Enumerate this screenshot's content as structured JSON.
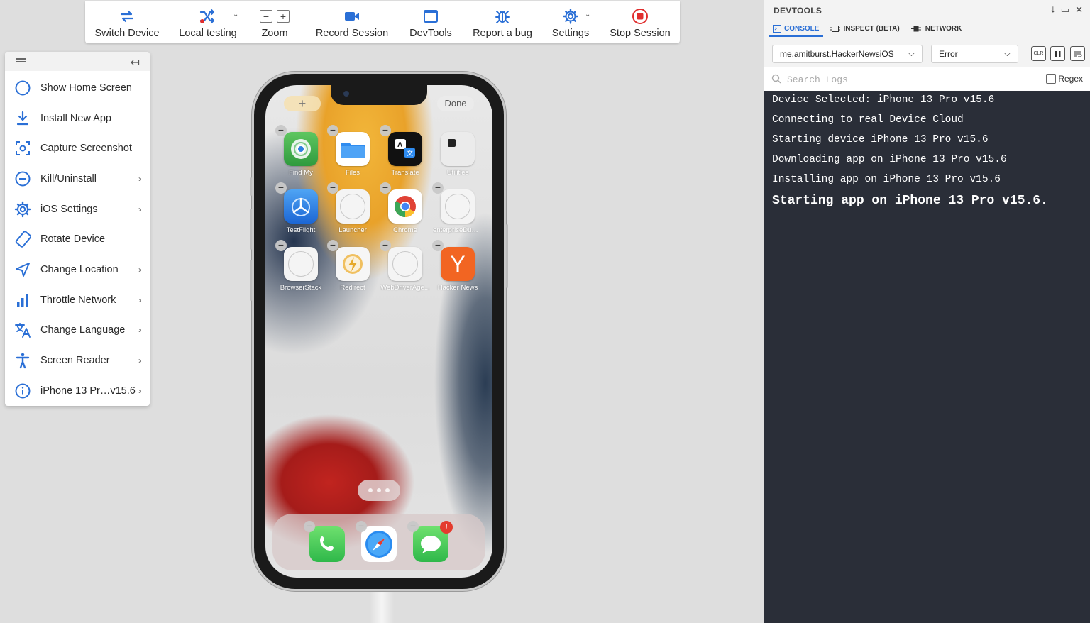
{
  "toolbar": {
    "items": [
      {
        "label": "Switch Device",
        "icon": "switch-arrows-icon"
      },
      {
        "label": "Local testing",
        "icon": "shuffle-icon"
      },
      {
        "label": "Zoom",
        "icon": "zoom-minus-plus-icon",
        "minus": "−",
        "plus": "+"
      },
      {
        "label": "Record Session",
        "icon": "video-camera-icon"
      },
      {
        "label": "DevTools",
        "icon": "window-icon"
      },
      {
        "label": "Report a bug",
        "icon": "bug-icon"
      },
      {
        "label": "Settings",
        "icon": "gear-icon"
      },
      {
        "label": "Stop Session",
        "icon": "stop-circle-icon"
      }
    ],
    "accent": "#2a6fd6",
    "stop_color": "#e02e2e"
  },
  "sidemenu": {
    "collapse_icon": "↤",
    "items": [
      {
        "label": "Show Home Screen",
        "icon": "circle-icon",
        "chevron": ""
      },
      {
        "label": "Install New App",
        "icon": "download-icon",
        "chevron": ""
      },
      {
        "label": "Capture Screenshot",
        "icon": "screenshot-icon",
        "chevron": ""
      },
      {
        "label": "Kill/Uninstall",
        "icon": "minus-circle-icon",
        "chevron": "›"
      },
      {
        "label": "iOS Settings",
        "icon": "gear-icon",
        "chevron": "›"
      },
      {
        "label": "Rotate Device",
        "icon": "rotate-icon",
        "chevron": ""
      },
      {
        "label": "Change Location",
        "icon": "location-arrow-icon",
        "chevron": "›"
      },
      {
        "label": "Throttle Network",
        "icon": "bar-chart-icon",
        "chevron": "›"
      },
      {
        "label": "Change Language",
        "icon": "translate-icon",
        "chevron": "›"
      },
      {
        "label": "Screen Reader",
        "icon": "accessibility-icon",
        "chevron": "›"
      },
      {
        "label": "iPhone 13 Pr…v15.6",
        "icon": "info-icon",
        "chevron": "›"
      }
    ]
  },
  "phone": {
    "plus_label": "+",
    "done_label": "Done",
    "apps": [
      {
        "label": "Find My",
        "color": "#3fa447"
      },
      {
        "label": "Files",
        "color": "#2f8cf0"
      },
      {
        "label": "Translate",
        "color": "#111111"
      },
      {
        "label": "Utilities",
        "color": "#e7e7e7"
      },
      {
        "label": "TestFlight",
        "color": "#2d7fe0"
      },
      {
        "label": "Launcher",
        "color": "#f4f4f4"
      },
      {
        "label": "Chrome",
        "color": "#ffffff"
      },
      {
        "label": "enterpriseDum...",
        "color": "#f4f4f4"
      },
      {
        "label": "BrowserStack",
        "color": "#f4f4f4"
      },
      {
        "label": "Redirect",
        "color": "#f6f6f6"
      },
      {
        "label": "WebDriverAge...",
        "color": "#f4f4f4"
      },
      {
        "label": "Hacker News",
        "color": "#f26522"
      }
    ],
    "hn_letter": "Y",
    "dock": [
      {
        "name": "phone-app",
        "color": "#3fc94f"
      },
      {
        "name": "safari-app",
        "color": "#ffffff"
      },
      {
        "name": "messages-app",
        "color": "#3fc94f",
        "badge": "!"
      }
    ]
  },
  "devtools": {
    "title": "DEVTOOLS",
    "tabs": [
      "CONSOLE",
      "INSPECT (BETA)",
      "NETWORK"
    ],
    "active_tab": "CONSOLE",
    "app_select": "me.amitburst.HackerNewsiOS",
    "level_select": "Error",
    "clear_label": "CLR",
    "search_placeholder": "Search Logs",
    "regex_label": "Regex",
    "logs": [
      "Device Selected: iPhone 13 Pro v15.6",
      "Connecting to real Device Cloud",
      "Starting device iPhone 13 Pro v15.6",
      "Downloading app on iPhone 13 Pro v15.6",
      "Installing app on iPhone 13 Pro v15.6",
      "Starting app on iPhone 13 Pro v15.6."
    ]
  }
}
